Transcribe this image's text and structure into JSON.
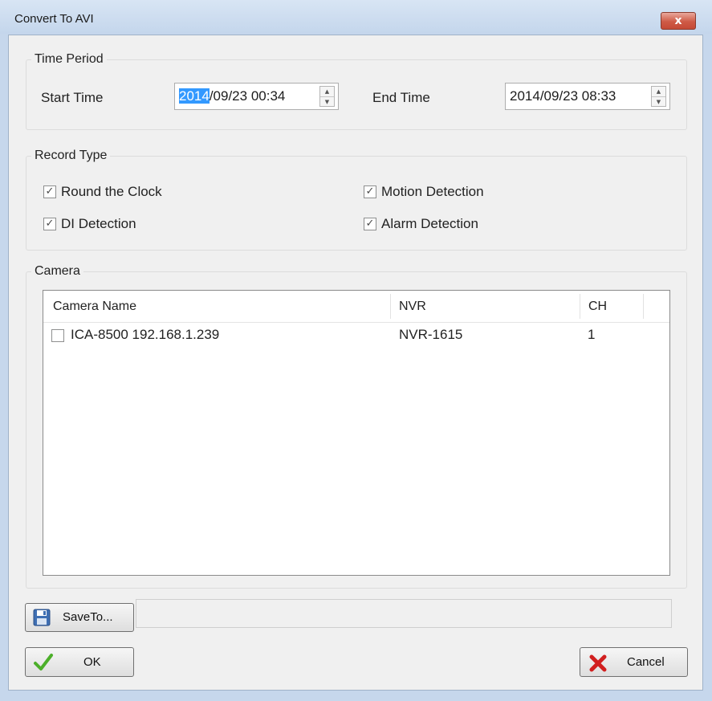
{
  "window": {
    "title": "Convert To AVI",
    "close_glyph": "x"
  },
  "time_period": {
    "legend": "Time Period",
    "start_label": "Start Time",
    "start_value_selected": "2014",
    "start_value_rest": "/09/23 00:34",
    "end_label": "End Time",
    "end_value": "2014/09/23 08:33"
  },
  "record_type": {
    "legend": "Record Type",
    "options": [
      {
        "label": "Round the Clock",
        "checked": true
      },
      {
        "label": "Motion Detection",
        "checked": true
      },
      {
        "label": "DI Detection",
        "checked": true
      },
      {
        "label": "Alarm Detection",
        "checked": true
      }
    ]
  },
  "camera": {
    "legend": "Camera",
    "columns": [
      "Camera Name",
      "NVR",
      "CH"
    ],
    "rows": [
      {
        "name": "ICA-8500 192.168.1.239",
        "nvr": "NVR-1615",
        "ch": "1",
        "checked": false
      }
    ]
  },
  "footer": {
    "save_to_label": "SaveTo...",
    "save_path": "",
    "ok_label": "OK",
    "cancel_label": "Cancel"
  },
  "icons": {
    "save": "floppy-disk-icon",
    "ok": "green-check-icon",
    "cancel": "red-x-icon"
  },
  "colors": {
    "selection": "#3399ff",
    "ok_check": "#4caf2a",
    "cancel_x": "#d11f1f",
    "close_button": "#cf5a46"
  }
}
